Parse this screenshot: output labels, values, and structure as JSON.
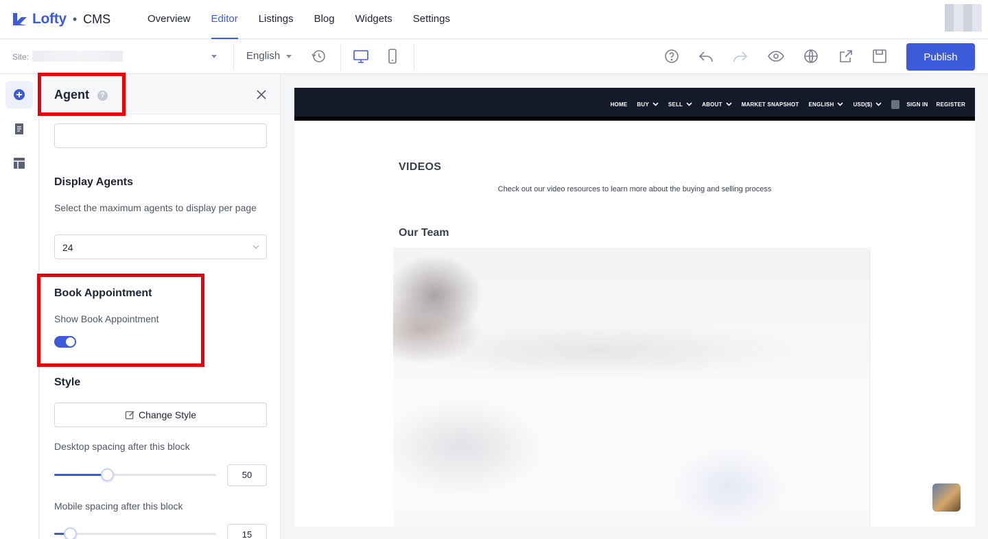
{
  "app": {
    "brand": "Lofty",
    "separator": "•",
    "product": "CMS"
  },
  "nav": {
    "items": [
      {
        "label": "Overview",
        "active": false
      },
      {
        "label": "Editor",
        "active": true
      },
      {
        "label": "Listings",
        "active": false
      },
      {
        "label": "Blog",
        "active": false
      },
      {
        "label": "Widgets",
        "active": false
      },
      {
        "label": "Settings",
        "active": false
      }
    ]
  },
  "toolbar": {
    "site_label": "Site:",
    "language": "English",
    "publish_label": "Publish",
    "icons": [
      "history-icon",
      "desktop-icon",
      "mobile-icon",
      "help-icon",
      "undo-icon",
      "redo-icon",
      "preview-icon",
      "globe-icon",
      "share-icon",
      "save-icon"
    ]
  },
  "panel": {
    "title": "Agent",
    "help_glyph": "?",
    "display_agents": {
      "title": "Display Agents",
      "description": "Select the maximum agents to display per page",
      "value": "24"
    },
    "book_appointment": {
      "title": "Book Appointment",
      "label": "Show Book Appointment",
      "enabled": true
    },
    "style": {
      "title": "Style",
      "button_label": "Change Style"
    },
    "desktop_spacing": {
      "label": "Desktop spacing after this block",
      "value": "50",
      "fraction": 0.33
    },
    "mobile_spacing": {
      "label": "Mobile spacing after this block",
      "value": "15",
      "fraction": 0.1
    }
  },
  "preview": {
    "site_nav": [
      {
        "label": "HOME",
        "dropdown": false
      },
      {
        "label": "BUY",
        "dropdown": true
      },
      {
        "label": "SELL",
        "dropdown": true
      },
      {
        "label": "ABOUT",
        "dropdown": true
      },
      {
        "label": "MARKET SNAPSHOT",
        "dropdown": false
      },
      {
        "label": "ENGLISH",
        "dropdown": true
      },
      {
        "label": "USD($)",
        "dropdown": true
      }
    ],
    "sign_in": "SIGN IN",
    "register": "REGISTER",
    "videos_title": "VIDEOS",
    "videos_desc": "Check out our video resources to learn more about the buying and selling process",
    "team_title": "Our Team"
  },
  "colors": {
    "accent": "#3b5bdb",
    "highlight": "#e8000b",
    "site_nav_bg": "#151a2b"
  }
}
